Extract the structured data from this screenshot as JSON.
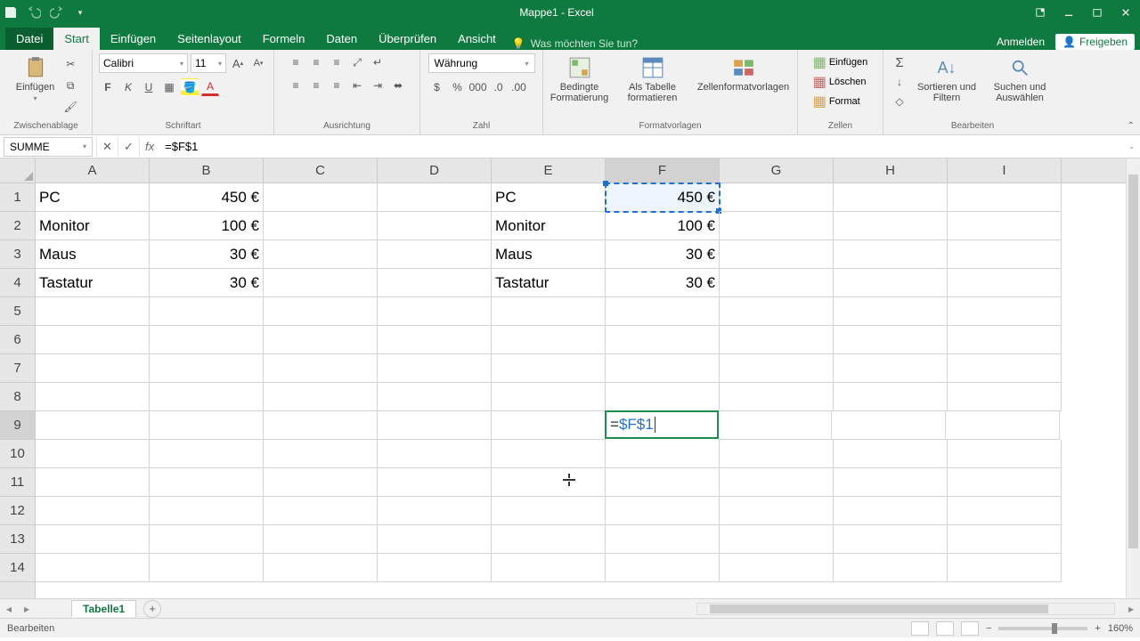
{
  "titlebar": {
    "title": "Mappe1 - Excel"
  },
  "tabs": {
    "file": "Datei",
    "home": "Start",
    "insert": "Einfügen",
    "layout": "Seitenlayout",
    "formulas": "Formeln",
    "data": "Daten",
    "review": "Überprüfen",
    "view": "Ansicht",
    "tell_me": "Was möchten Sie tun?",
    "signin": "Anmelden",
    "share": "Freigeben"
  },
  "ribbon": {
    "clipboard": {
      "paste": "Einfügen",
      "label": "Zwischenablage"
    },
    "font": {
      "name": "Calibri",
      "size": "11",
      "label": "Schriftart",
      "bold": "F",
      "italic": "K",
      "underline": "U"
    },
    "alignment": {
      "label": "Ausrichtung"
    },
    "number": {
      "format": "Währung",
      "label": "Zahl"
    },
    "styles": {
      "cond": "Bedingte Formatierung",
      "table": "Als Tabelle formatieren",
      "cell": "Zellenformatvorlagen",
      "label": "Formatvorlagen"
    },
    "cells": {
      "insert": "Einfügen",
      "delete": "Löschen",
      "format": "Format",
      "label": "Zellen"
    },
    "editing": {
      "sort": "Sortieren und Filtern",
      "find": "Suchen und Auswählen",
      "label": "Bearbeiten"
    }
  },
  "formula_bar": {
    "name_box": "SUMME",
    "formula": "=$F$1"
  },
  "columns": [
    "A",
    "B",
    "C",
    "D",
    "E",
    "F",
    "G",
    "H",
    "I"
  ],
  "rows": [
    "1",
    "2",
    "3",
    "4",
    "5",
    "6",
    "7",
    "8",
    "9",
    "10",
    "11",
    "12",
    "13",
    "14"
  ],
  "data": {
    "A1": "PC",
    "B1": "450 €",
    "E1": "PC",
    "F1": "450 €",
    "A2": "Monitor",
    "B2": "100 €",
    "E2": "Monitor",
    "F2": "100 €",
    "A3": "Maus",
    "B3": "30 €",
    "E3": "Maus",
    "F3": "30 €",
    "A4": "Tastatur",
    "B4": "30 €",
    "E4": "Tastatur",
    "F4": "30 €"
  },
  "edit_cell": {
    "eq": "=",
    "ref": "$F$1"
  },
  "sheet": {
    "tab1": "Tabelle1"
  },
  "status": {
    "mode": "Bearbeiten",
    "zoom": "160%"
  }
}
